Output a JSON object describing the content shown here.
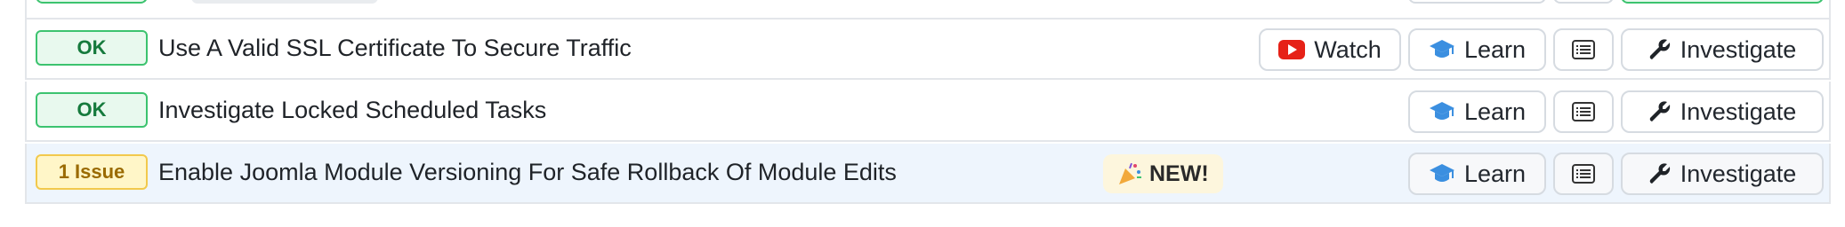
{
  "rows": [
    {
      "status": "OK",
      "title": "Use A Valid SSL Certificate To Secure Traffic",
      "watch_label": "Watch",
      "learn_label": "Learn",
      "investigate_label": "Investigate"
    },
    {
      "status": "OK",
      "title": "Investigate Locked Scheduled Tasks",
      "learn_label": "Learn",
      "investigate_label": "Investigate"
    },
    {
      "status": "1 Issue",
      "title": "Enable Joomla Module Versioning For Safe Rollback Of Module Edits",
      "new_badge": "NEW!",
      "learn_label": "Learn",
      "investigate_label": "Investigate"
    }
  ],
  "colors": {
    "ok_bg": "#e8f9ee",
    "ok_border": "#3cc36f",
    "issue_bg": "#fff6c8",
    "issue_border": "#f2c94c",
    "learn_icon": "#3b8fe0",
    "highlight_row": "#eef5fd"
  },
  "icons": {
    "watch": "youtube-icon",
    "learn": "graduation-cap-icon",
    "list": "list-icon",
    "investigate": "wrench-icon",
    "new": "party-popper-icon"
  }
}
